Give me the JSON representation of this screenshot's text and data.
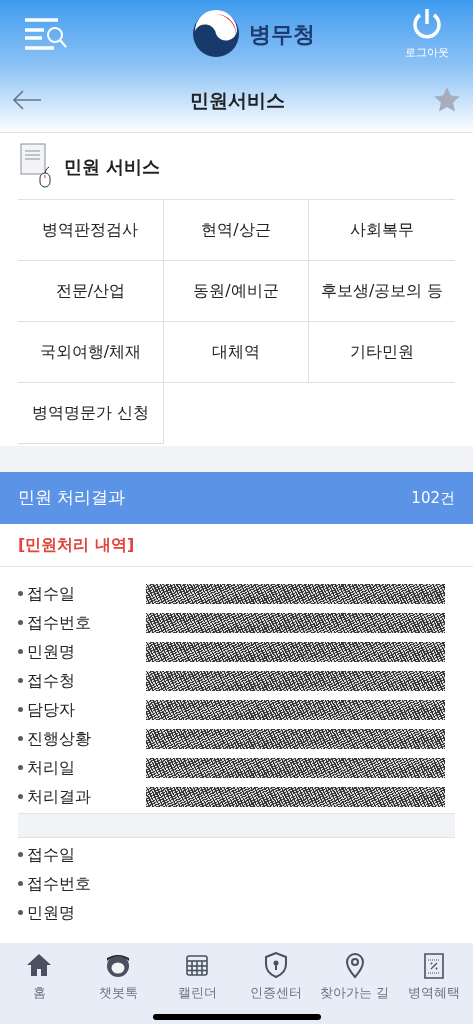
{
  "top_bar": {
    "logo_text": "병무청",
    "logout_label": "로그아웃"
  },
  "title_bar": {
    "title": "민원서비스",
    "favorite": false
  },
  "section": {
    "title": "민원 서비스"
  },
  "menu": [
    {
      "label": "병역판정검사"
    },
    {
      "label": "현역/상근"
    },
    {
      "label": "사회복무"
    },
    {
      "label": "전문/산업"
    },
    {
      "label": "동원/예비군"
    },
    {
      "label": "후보생/공보의 등"
    },
    {
      "label": "국외여행/체재"
    },
    {
      "label": "대체역"
    },
    {
      "label": "기타민원"
    },
    {
      "label": "병역명문가 신청"
    }
  ],
  "results": {
    "title": "민원 처리결과",
    "count": "102건",
    "subtitle": "[민원처리 내역]"
  },
  "records": [
    {
      "fields": [
        {
          "label": "접수일",
          "redacted": true
        },
        {
          "label": "접수번호",
          "redacted": true
        },
        {
          "label": "민원명",
          "redacted": true
        },
        {
          "label": "접수청",
          "redacted": true
        },
        {
          "label": "담당자",
          "redacted": true
        },
        {
          "label": "진행상황",
          "redacted": true
        },
        {
          "label": "처리일",
          "redacted": true
        },
        {
          "label": "처리결과",
          "redacted": true
        }
      ]
    },
    {
      "fields": [
        {
          "label": "접수일",
          "redacted": false
        },
        {
          "label": "접수번호",
          "redacted": false
        },
        {
          "label": "민원명",
          "redacted": false
        }
      ]
    }
  ],
  "bottom_nav": [
    {
      "kind": "home",
      "label": "홈"
    },
    {
      "kind": "chatbot",
      "label": "챗봇톡"
    },
    {
      "kind": "calendar",
      "label": "캘린더"
    },
    {
      "kind": "shield",
      "label": "인증센터"
    },
    {
      "kind": "pin",
      "label": "찾아가는 길"
    },
    {
      "kind": "coupon",
      "label": "병역혜택"
    }
  ]
}
